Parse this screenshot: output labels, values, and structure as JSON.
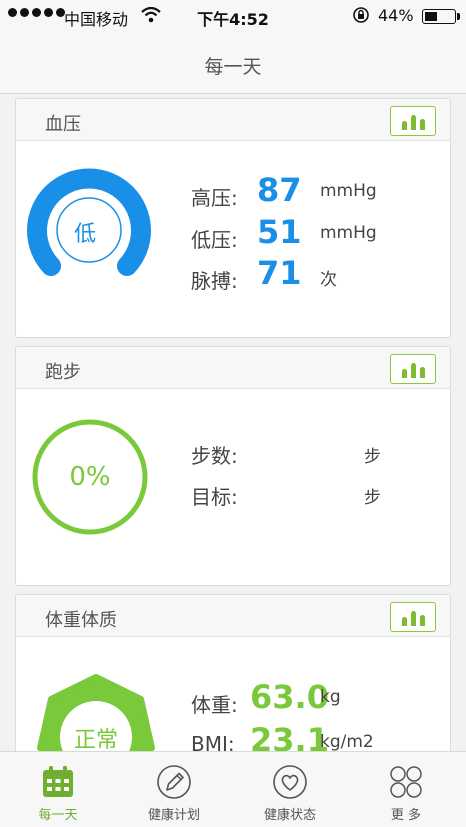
{
  "status_bar": {
    "carrier": "中国移动",
    "time": "下午4:52",
    "battery": "44%",
    "battery_level": 0.44
  },
  "nav": {
    "title": "每一天"
  },
  "blood_pressure": {
    "title": "血压",
    "gauge_label": "低",
    "systolic_label": "高压:",
    "systolic_value": "87",
    "systolic_unit": "mmHg",
    "diastolic_label": "低压:",
    "diastolic_value": "51",
    "diastolic_unit": "mmHg",
    "pulse_label": "脉搏:",
    "pulse_value": "71",
    "pulse_unit": "次"
  },
  "running": {
    "title": "跑步",
    "progress": "0%",
    "steps_label": "步数:",
    "steps_unit": "步",
    "goal_label": "目标:",
    "goal_unit": "步"
  },
  "body": {
    "title": "体重体质",
    "badge": "正常",
    "weight_label": "体重:",
    "weight_value": "63.0",
    "weight_unit": "kg",
    "bmi_label": "BMI:",
    "bmi_value": "23.1",
    "bmi_unit": "kg/m2"
  },
  "tabs": [
    {
      "label": "每一天",
      "icon": "calendar-icon"
    },
    {
      "label": "健康计划",
      "icon": "pencil-icon"
    },
    {
      "label": "健康状态",
      "icon": "heart-icon"
    },
    {
      "label": "更 多",
      "icon": "more-circles-icon"
    }
  ],
  "colors": {
    "blue": "#1a8fe8",
    "green": "#7ac93a",
    "accent": "#6fae2e"
  }
}
